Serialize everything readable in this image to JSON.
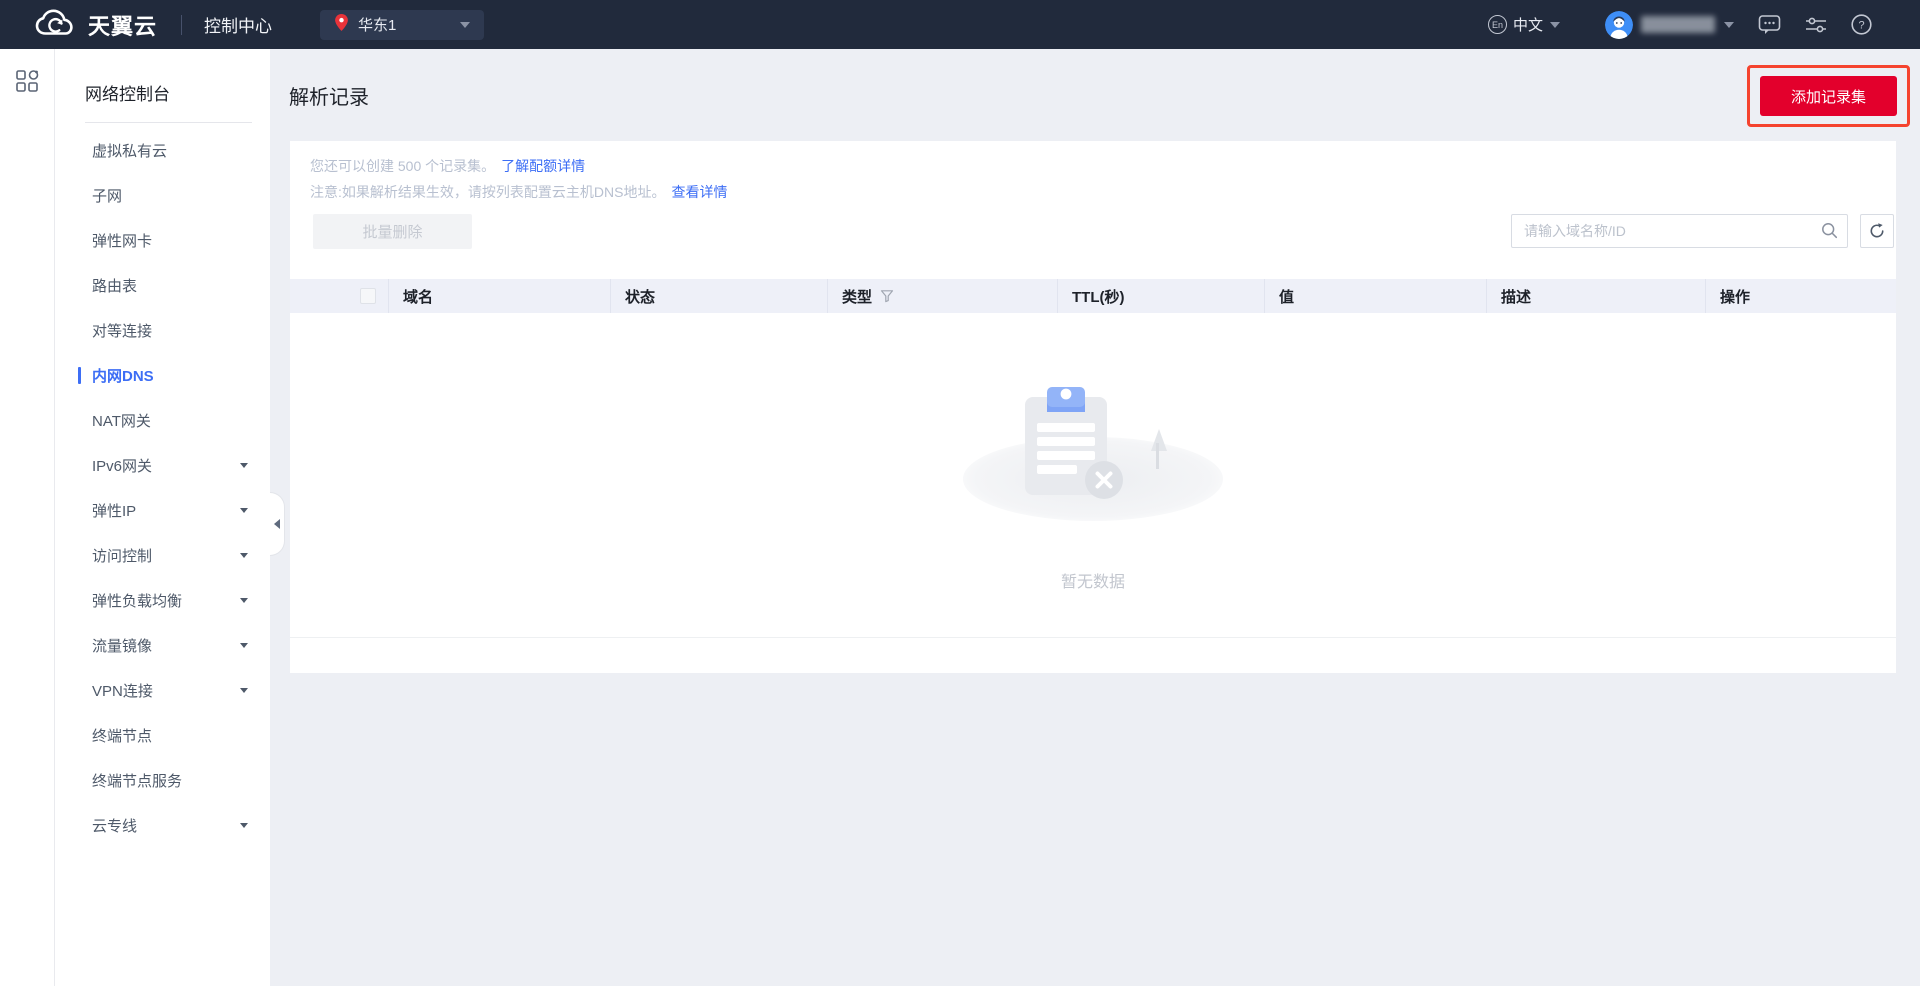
{
  "topbar": {
    "brand": "天翼云",
    "console_label": "控制中心",
    "region": {
      "value": "华东1"
    },
    "language": {
      "badge": "En",
      "label": "中文"
    }
  },
  "sidebar": {
    "title": "网络控制台",
    "items": [
      {
        "label": "虚拟私有云"
      },
      {
        "label": "子网"
      },
      {
        "label": "弹性网卡"
      },
      {
        "label": "路由表"
      },
      {
        "label": "对等连接"
      },
      {
        "label": "内网DNS",
        "active": true
      },
      {
        "label": "NAT网关"
      },
      {
        "label": "IPv6网关",
        "expandable": true
      },
      {
        "label": "弹性IP",
        "expandable": true
      },
      {
        "label": "访问控制",
        "expandable": true
      },
      {
        "label": "弹性负载均衡",
        "expandable": true
      },
      {
        "label": "流量镜像",
        "expandable": true
      },
      {
        "label": "VPN连接",
        "expandable": true
      },
      {
        "label": "终端节点"
      },
      {
        "label": "终端节点服务"
      },
      {
        "label": "云专线",
        "expandable": true
      }
    ]
  },
  "main": {
    "page_title": "解析记录",
    "add_button_label": "添加记录集",
    "notice": {
      "line1_text": "您还可以创建 500 个记录集。",
      "line1_link": "了解配额详情",
      "line2_text": "注意:如果解析结果生效，请按列表配置云主机DNS地址。",
      "line2_link": "查看详情"
    },
    "toolbar": {
      "batch_delete_label": "批量删除",
      "search_placeholder": "请输入域名称/ID"
    },
    "table": {
      "columns": [
        "域名",
        "状态",
        "类型",
        "TTL(秒)",
        "值",
        "描述",
        "操作"
      ],
      "rows": [],
      "empty_text": "暂无数据"
    }
  },
  "colors": {
    "brand_red": "#e3002c",
    "annotation_red": "#f5432e",
    "link_blue": "#3d6ef5",
    "topbar_bg": "#212a3c",
    "table_header_bg": "#eef0f8"
  }
}
